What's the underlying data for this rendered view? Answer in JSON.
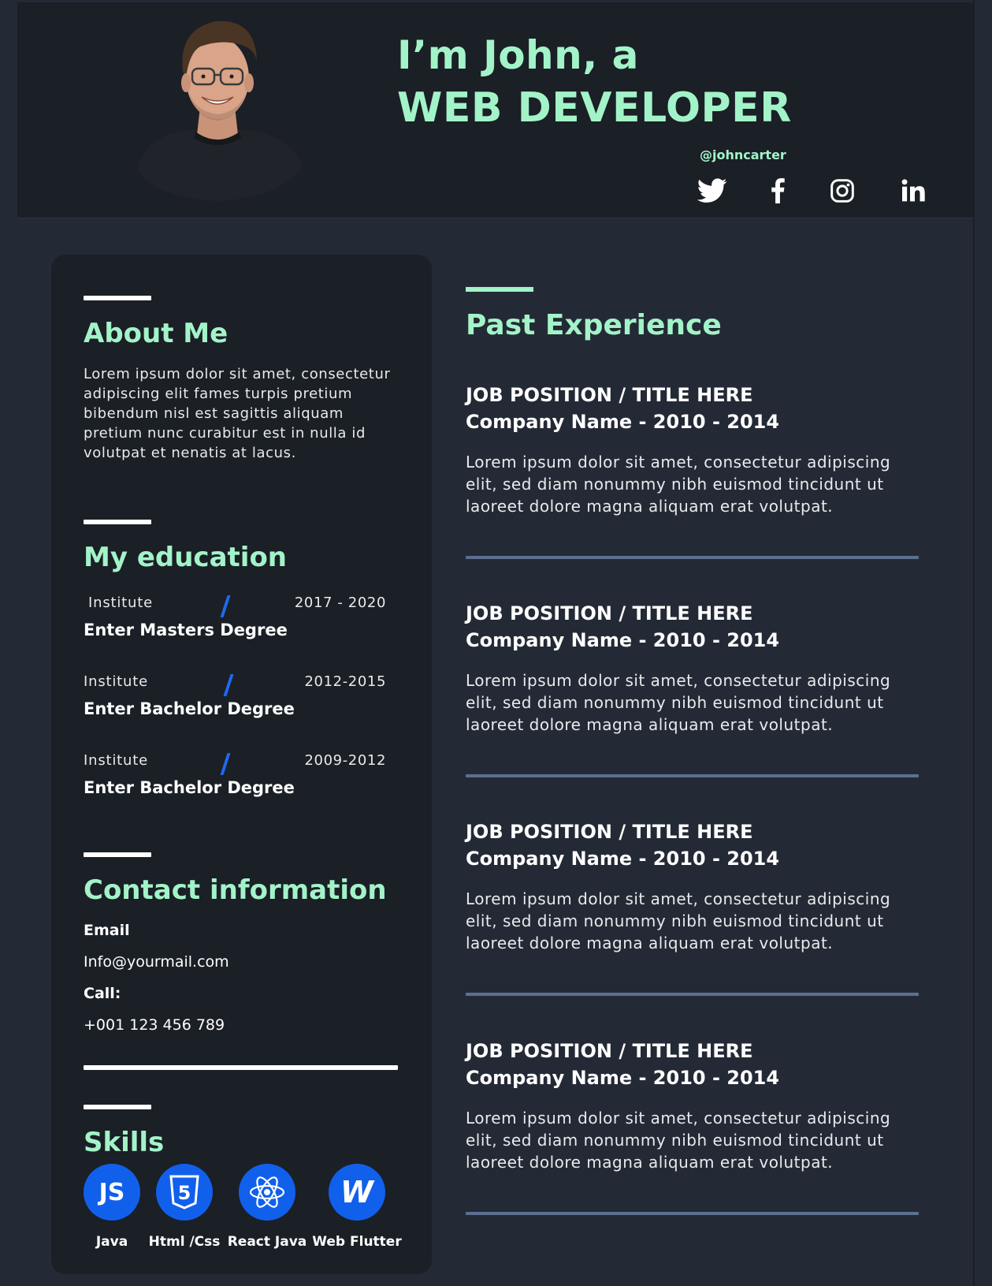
{
  "colors": {
    "accent": "#a3f3c9",
    "blue": "#1160ec",
    "divider": "#5b7090",
    "bg": "#242a35",
    "panel": "#1b1f26"
  },
  "header": {
    "line1": "I’m John, a",
    "line2": "WEB DEVELOPER",
    "handle": "@johncarter",
    "socials": [
      {
        "icon": "twitter-icon"
      },
      {
        "icon": "facebook-icon"
      },
      {
        "icon": "instagram-icon"
      },
      {
        "icon": "linkedin-icon"
      }
    ]
  },
  "about": {
    "title": "About Me",
    "text": "Lorem ipsum dolor sit amet, consectetur adipiscing elit fames turpis pretium bibendum nisl est sagittis aliquam pretium nunc curabitur est in nulla id volutpat et nenatis at lacus."
  },
  "education": {
    "title": "My education",
    "items": [
      {
        "institute": "Institute",
        "years": "2017 - 2020",
        "degree": "Enter Masters Degree"
      },
      {
        "institute": "Institute",
        "years": "2012-2015",
        "degree": "Enter Bachelor Degree"
      },
      {
        "institute": "Institute",
        "years": "2009-2012",
        "degree": "Enter Bachelor Degree"
      }
    ]
  },
  "contact": {
    "title": "Contact information",
    "email_label": "Email",
    "email": "Info@yourmail.com",
    "call_label": "Call:",
    "phone": "+001 123 456 789"
  },
  "skills": {
    "title": "Skills",
    "items": [
      {
        "label": "Java",
        "icon": "javascript-icon",
        "glyph": "JS"
      },
      {
        "label": "Html /Css",
        "icon": "html5-icon",
        "glyph": "5"
      },
      {
        "label": "React Java",
        "icon": "react-icon"
      },
      {
        "label": "Web Flutter",
        "icon": "webflow-icon",
        "glyph": "W"
      }
    ]
  },
  "experience": {
    "title": "Past Experience",
    "jobs": [
      {
        "title": "JOB POSITION / TITLE HERE",
        "company": "Company Name  - 2010 - 2014",
        "desc": "Lorem ipsum dolor sit amet, consectetur adipiscing elit, sed diam nonummy nibh euismod tincidunt ut laoreet dolore magna aliquam erat volutpat."
      },
      {
        "title": "JOB POSITION / TITLE HERE",
        "company": "Company Name  - 2010 - 2014",
        "desc": "Lorem ipsum dolor sit amet, consectetur adipiscing elit, sed diam nonummy nibh euismod tincidunt ut laoreet dolore magna aliquam erat volutpat."
      },
      {
        "title": "JOB POSITION / TITLE HERE",
        "company": "Company Name  - 2010 - 2014",
        "desc": "Lorem ipsum dolor sit amet, consectetur adipiscing elit, sed diam nonummy nibh euismod tincidunt ut laoreet dolore magna aliquam erat volutpat."
      },
      {
        "title": "JOB POSITION / TITLE HERE",
        "company": "Company Name  - 2010 - 2014",
        "desc": "Lorem ipsum dolor sit amet, consectetur adipiscing elit, sed diam nonummy nibh euismod tincidunt ut laoreet dolore magna aliquam erat volutpat."
      }
    ]
  }
}
